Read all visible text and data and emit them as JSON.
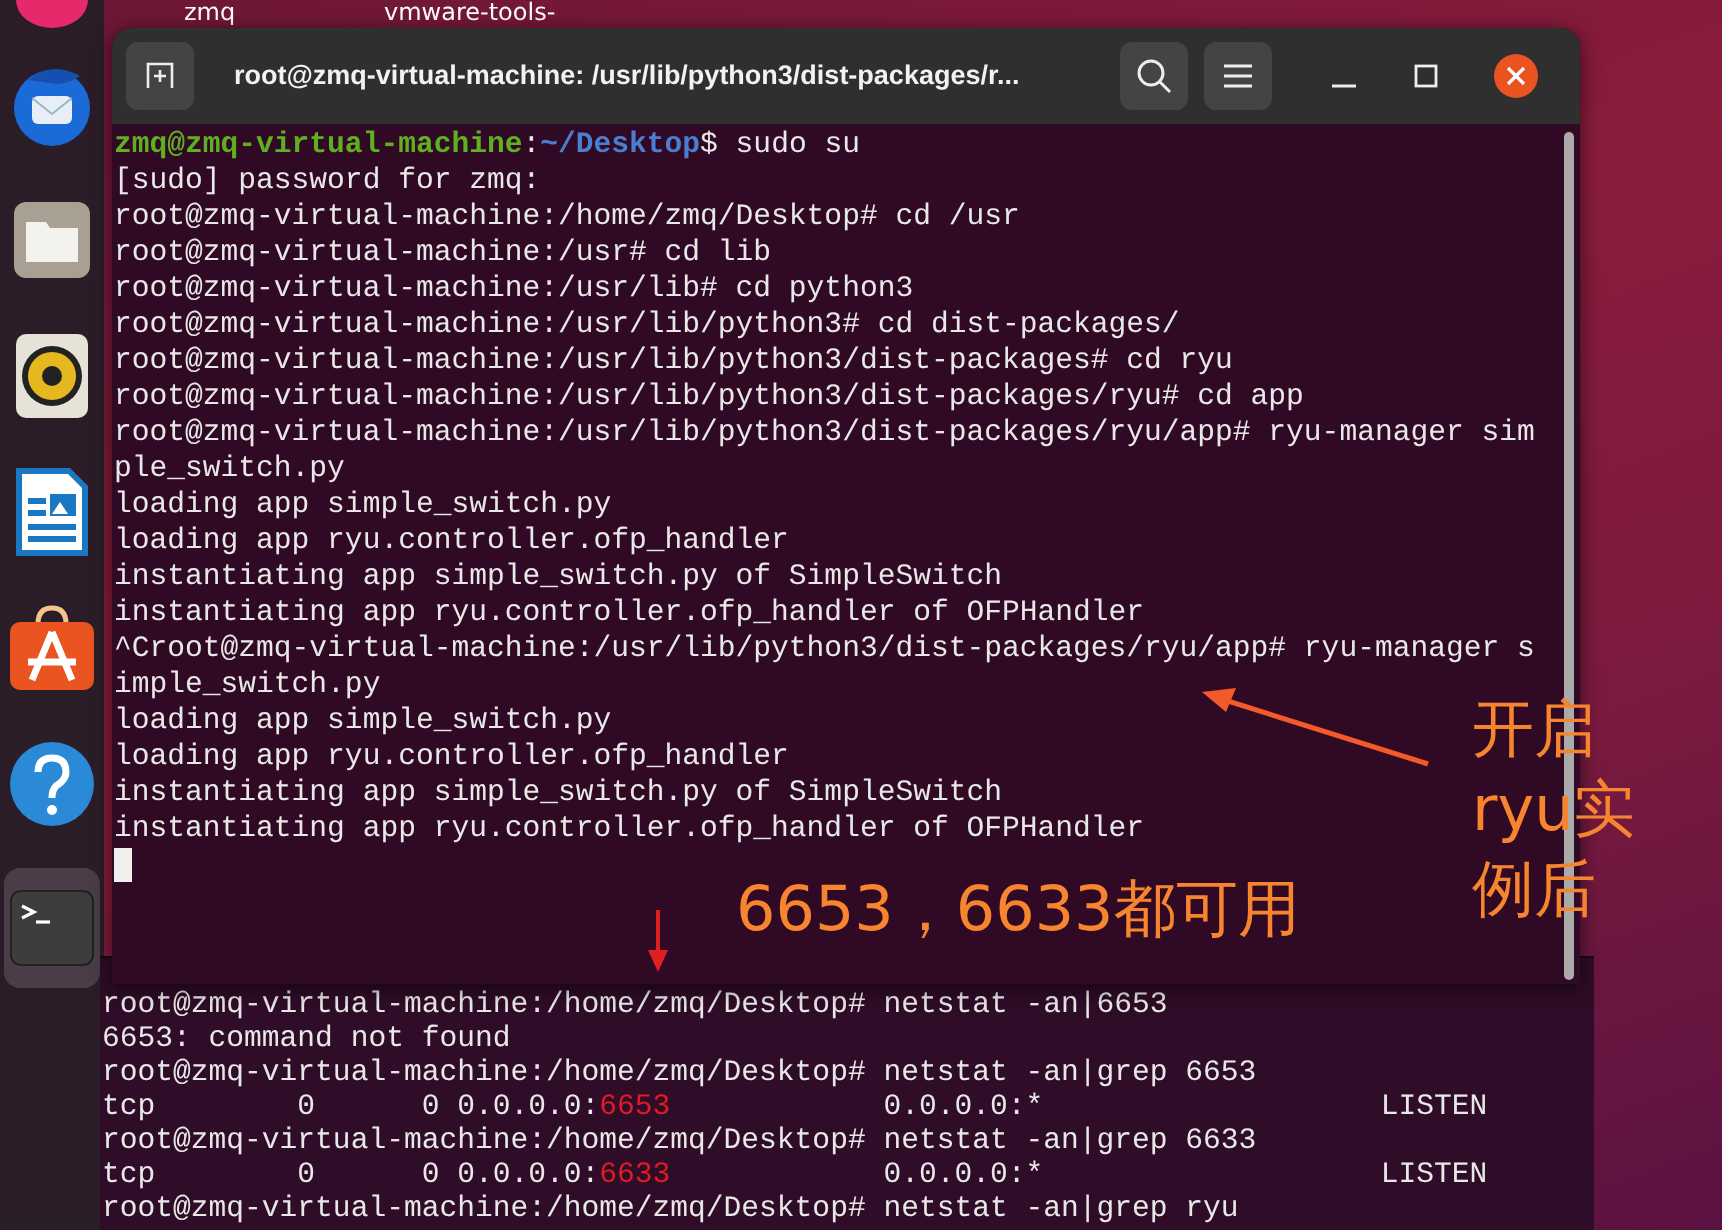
{
  "desktop_icons": [
    {
      "label": "zmq"
    },
    {
      "label": "vmware-tools-"
    }
  ],
  "dock": {
    "items": [
      {
        "kind": "partial",
        "selected": false
      },
      {
        "kind": "mail",
        "selected": false
      },
      {
        "kind": "files",
        "selected": false
      },
      {
        "kind": "music",
        "selected": false
      },
      {
        "kind": "writer",
        "selected": false
      },
      {
        "kind": "store",
        "selected": false
      },
      {
        "kind": "help",
        "selected": false
      },
      {
        "kind": "terminal",
        "selected": true
      }
    ]
  },
  "terminal": {
    "title": "root@zmq-virtual-machine: /usr/lib/python3/dist-packages/r...",
    "lines": [
      {
        "segments": [
          {
            "text": "zmq@zmq-virtual-machine",
            "kind": "user"
          },
          {
            "text": ":",
            "kind": "text"
          },
          {
            "text": "~/Desktop",
            "kind": "path"
          },
          {
            "text": "$ sudo su",
            "kind": "text"
          }
        ]
      },
      {
        "segments": [
          {
            "text": "[sudo] password for zmq:",
            "kind": "text"
          }
        ]
      },
      {
        "segments": [
          {
            "text": "root@zmq-virtual-machine:/home/zmq/Desktop# cd /usr",
            "kind": "text"
          }
        ]
      },
      {
        "segments": [
          {
            "text": "root@zmq-virtual-machine:/usr# cd lib",
            "kind": "text"
          }
        ]
      },
      {
        "segments": [
          {
            "text": "root@zmq-virtual-machine:/usr/lib# cd python3",
            "kind": "text"
          }
        ]
      },
      {
        "segments": [
          {
            "text": "root@zmq-virtual-machine:/usr/lib/python3# cd dist-packages/",
            "kind": "text"
          }
        ]
      },
      {
        "segments": [
          {
            "text": "root@zmq-virtual-machine:/usr/lib/python3/dist-packages# cd ryu",
            "kind": "text"
          }
        ]
      },
      {
        "segments": [
          {
            "text": "root@zmq-virtual-machine:/usr/lib/python3/dist-packages/ryu# cd app",
            "kind": "text"
          }
        ]
      },
      {
        "segments": [
          {
            "text": "root@zmq-virtual-machine:/usr/lib/python3/dist-packages/ryu/app# ryu-manager sim",
            "kind": "text"
          }
        ]
      },
      {
        "segments": [
          {
            "text": "ple_switch.py",
            "kind": "text"
          }
        ]
      },
      {
        "segments": [
          {
            "text": "loading app simple_switch.py",
            "kind": "text"
          }
        ]
      },
      {
        "segments": [
          {
            "text": "loading app ryu.controller.ofp_handler",
            "kind": "text"
          }
        ]
      },
      {
        "segments": [
          {
            "text": "instantiating app simple_switch.py of SimpleSwitch",
            "kind": "text"
          }
        ]
      },
      {
        "segments": [
          {
            "text": "instantiating app ryu.controller.ofp_handler of OFPHandler",
            "kind": "text"
          }
        ]
      },
      {
        "segments": [
          {
            "text": "^Croot@zmq-virtual-machine:/usr/lib/python3/dist-packages/ryu/app# ryu-manager s",
            "kind": "text"
          }
        ]
      },
      {
        "segments": [
          {
            "text": "imple_switch.py",
            "kind": "text"
          }
        ]
      },
      {
        "segments": [
          {
            "text": "loading app simple_switch.py",
            "kind": "text"
          }
        ]
      },
      {
        "segments": [
          {
            "text": "loading app ryu.controller.ofp_handler",
            "kind": "text"
          }
        ]
      },
      {
        "segments": [
          {
            "text": "instantiating app simple_switch.py of SimpleSwitch",
            "kind": "text"
          }
        ]
      },
      {
        "segments": [
          {
            "text": "instantiating app ryu.controller.ofp_handler of OFPHandler",
            "kind": "text"
          }
        ]
      }
    ]
  },
  "back_terminal": {
    "lines": [
      {
        "segments": [
          {
            "text": "root@zmq-virtual-machine:/home/zmq/Desktop# netstat -an|6653",
            "kind": "text"
          }
        ]
      },
      {
        "segments": [
          {
            "text": "6653: command not found",
            "kind": "text"
          }
        ]
      },
      {
        "segments": [
          {
            "text": "root@zmq-virtual-machine:/home/zmq/Desktop# netstat -an|grep 6653",
            "kind": "text"
          }
        ]
      },
      {
        "segments": [
          {
            "text": "tcp        0      0 0.0.0.0:",
            "kind": "text"
          },
          {
            "text": "6653",
            "kind": "port"
          },
          {
            "text": "            0.0.0.0:*                   LISTEN",
            "kind": "text"
          }
        ]
      },
      {
        "segments": [
          {
            "text": "root@zmq-virtual-machine:/home/zmq/Desktop# netstat -an|grep 6633",
            "kind": "text"
          }
        ]
      },
      {
        "segments": [
          {
            "text": "tcp        0      0 0.0.0.0:",
            "kind": "text"
          },
          {
            "text": "6633",
            "kind": "port"
          },
          {
            "text": "            0.0.0.0:*                   LISTEN",
            "kind": "text"
          }
        ]
      },
      {
        "segments": [
          {
            "text": "root@zmq-virtual-machine:/home/zmq/Desktop# netstat -an|grep ryu",
            "kind": "text"
          }
        ]
      }
    ]
  },
  "annotations": [
    {
      "kind": "center",
      "text": "6653，6633都可用"
    },
    {
      "kind": "side",
      "text": "开启ryu实例后"
    }
  ]
}
